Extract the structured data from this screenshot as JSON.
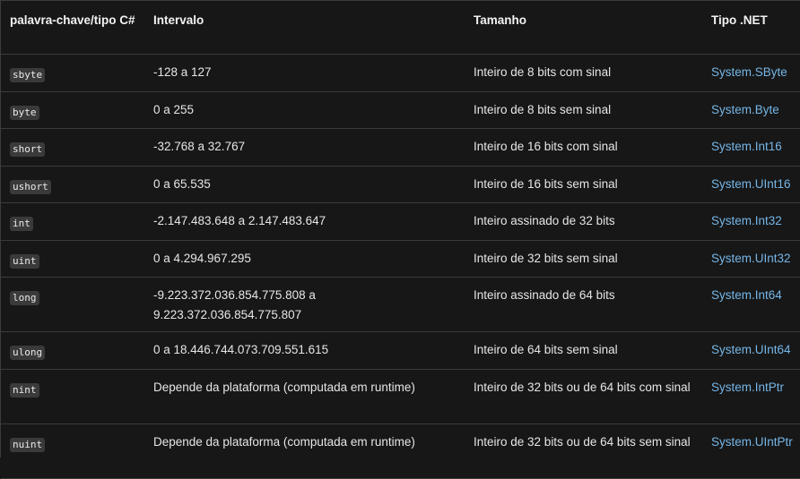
{
  "header": {
    "keyword": "palavra-chave/tipo C#",
    "range": "Intervalo",
    "size": "Tamanho",
    "net_type": "Tipo .NET"
  },
  "rows": [
    {
      "keyword": "sbyte",
      "range": "-128 a 127",
      "size": "Inteiro de 8 bits com sinal",
      "net_type": "System.SByte"
    },
    {
      "keyword": "byte",
      "range": "0 a 255",
      "size": "Inteiro de 8 bits sem sinal",
      "net_type": "System.Byte"
    },
    {
      "keyword": "short",
      "range": "-32.768 a 32.767",
      "size": "Inteiro de 16 bits com sinal",
      "net_type": "System.Int16"
    },
    {
      "keyword": "ushort",
      "range": "0 a 65.535",
      "size": "Inteiro de 16 bits sem sinal",
      "net_type": "System.UInt16"
    },
    {
      "keyword": "int",
      "range": "-2.147.483.648 a 2.147.483.647",
      "size": "Inteiro assinado de 32 bits",
      "net_type": "System.Int32"
    },
    {
      "keyword": "uint",
      "range": "0 a 4.294.967.295",
      "size": "Inteiro de 32 bits sem sinal",
      "net_type": "System.UInt32"
    },
    {
      "keyword": "long",
      "range": "-9.223.372.036.854.775.808 a 9.223.372.036.854.775.807",
      "size": "Inteiro assinado de 64 bits",
      "net_type": "System.Int64"
    },
    {
      "keyword": "ulong",
      "range": "0 a 18.446.744.073.709.551.615",
      "size": "Inteiro de 64 bits sem sinal",
      "net_type": "System.UInt64"
    },
    {
      "keyword": "nint",
      "range": "Depende da plataforma (computada em runtime)",
      "size": "Inteiro de 32 bits ou de 64 bits com sinal",
      "net_type": "System.IntPtr"
    },
    {
      "keyword": "nuint",
      "range": "Depende da plataforma (computada em runtime)",
      "size": "Inteiro de 32 bits ou de 64 bits sem sinal",
      "net_type": "System.UIntPtr"
    }
  ],
  "colors": {
    "background": "#171717",
    "text": "#e6e6e6",
    "link": "#75b6e7",
    "code_background": "#3a3a3a",
    "border": "#3b3b3b"
  }
}
